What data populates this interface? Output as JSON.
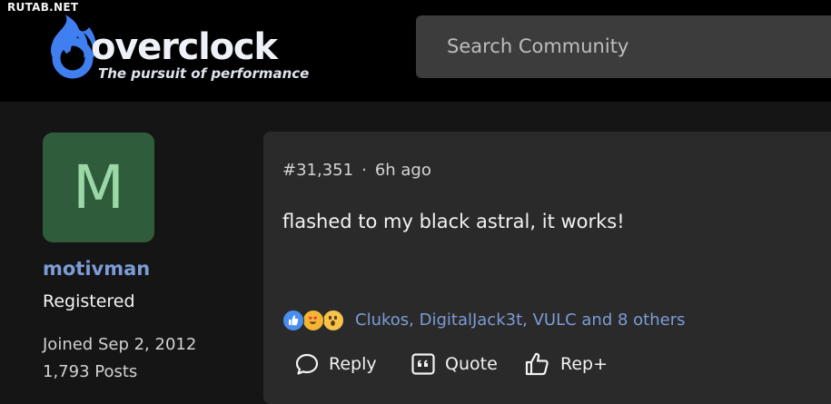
{
  "watermark": "RUTAB.NET",
  "site": {
    "logo_text": "overclock",
    "tagline": "The pursuit of performance"
  },
  "search": {
    "placeholder": "Search Community"
  },
  "author": {
    "avatar_letter": "M",
    "username": "motivman",
    "role": "Registered",
    "joined": "Joined Sep 2, 2012",
    "posts": "1,793 Posts"
  },
  "post": {
    "number": "#31,351",
    "separator": "·",
    "time": "6h ago",
    "body": "flashed to my black astral, it works!",
    "reactions": {
      "icons": [
        "like-icon",
        "love-eyes-icon",
        "wow-icon"
      ],
      "names": "Clukos, DigitalJack3t, VULC and 8 others"
    },
    "actions": {
      "reply": "Reply",
      "quote": "Quote",
      "rep": "Rep+"
    }
  },
  "colors": {
    "background": "#151515",
    "header": "#000000",
    "accent_blue": "#7c9cd6",
    "avatar_bg": "#2f5d3b",
    "avatar_letter": "#9bd7a7",
    "post_bg": "#2a2a2a"
  }
}
